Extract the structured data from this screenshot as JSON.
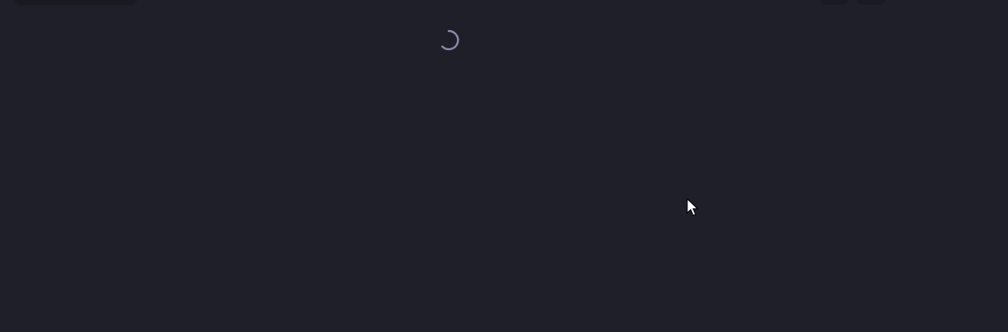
{
  "loading": {
    "state": "loading",
    "icon": "spinner-icon"
  },
  "cursor": {
    "icon": "mouse-pointer-icon"
  },
  "colors": {
    "background": "#1e1f28",
    "toolbar_shape": "#191a22",
    "spinner": "#8a8aa8",
    "cursor_fill": "#ffffff",
    "cursor_stroke": "#000000"
  }
}
